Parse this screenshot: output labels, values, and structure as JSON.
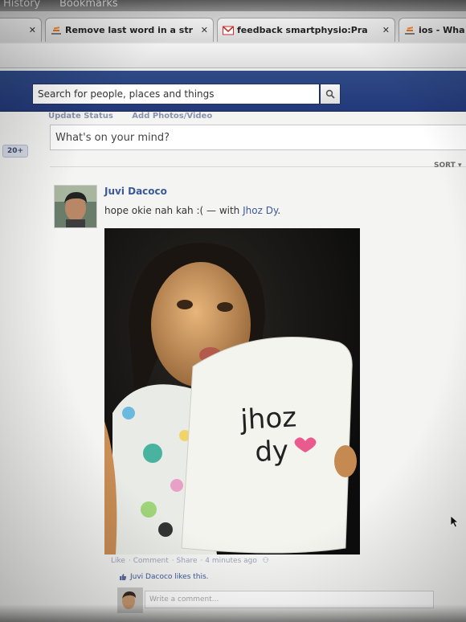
{
  "browser": {
    "menu": [
      "History",
      "Bookmarks"
    ],
    "tabs": [
      {
        "label": "",
        "closable": true
      },
      {
        "label": "Remove last word in a str",
        "closable": true
      },
      {
        "label": "feedback smartphysio:Pra",
        "closable": true
      },
      {
        "label": "ios - Wha",
        "closable": false
      }
    ]
  },
  "header": {
    "search_placeholder": "Search for people, places and things"
  },
  "composer": {
    "tabs": [
      "Update Status",
      "Add Photos/Video"
    ],
    "prompt": "What's on your mind?"
  },
  "sidebar": {
    "badge": "20+"
  },
  "feed": {
    "sort_label": "SORT",
    "post": {
      "author": "Juvi Dacoco",
      "text": "hope okie nah kah :(",
      "separator": " — with ",
      "tagged": "Jhoz Dy",
      "tagged_suffix": ".",
      "photo_sign_line1": "jhoz",
      "photo_sign_line2": "dy",
      "actions": [
        "Like",
        "Comment",
        "Share",
        "4 minutes ago"
      ],
      "likes_text": "Juvi Dacoco likes this.",
      "comment_placeholder": "Write a comment..."
    }
  }
}
